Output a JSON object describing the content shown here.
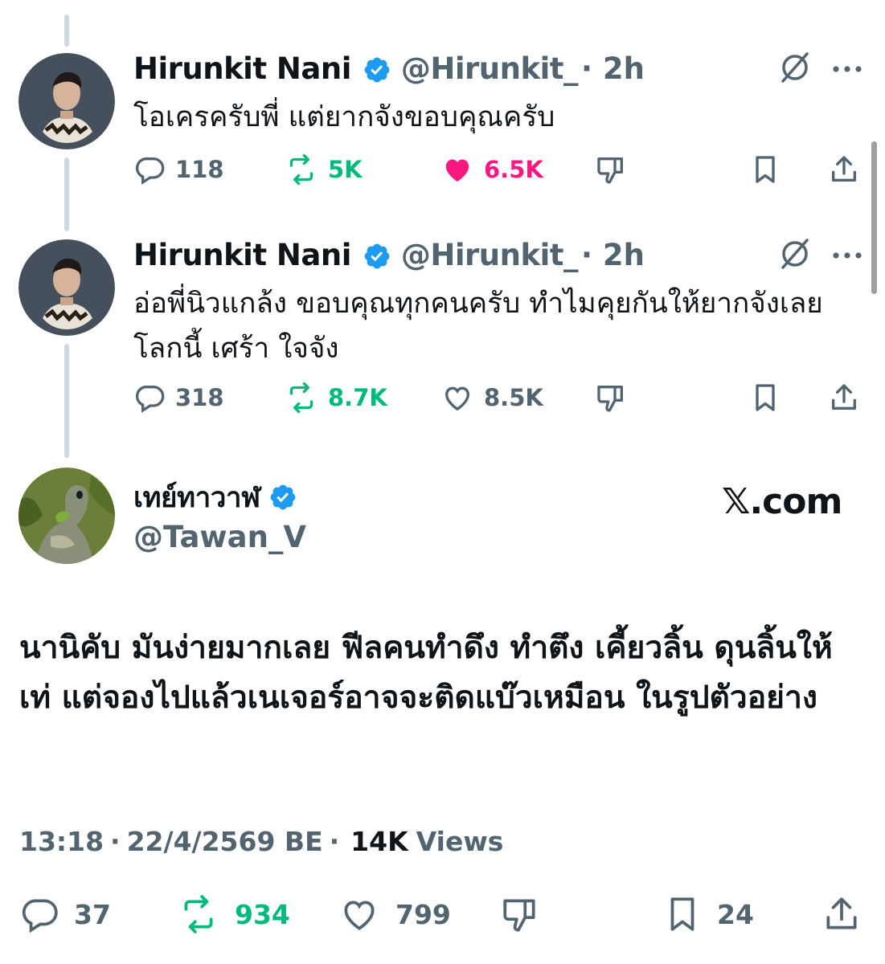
{
  "replies": [
    {
      "name": "Hirunkit Nani",
      "handle": "@Hirunkit_",
      "time": "· 2h",
      "text": "โอเครครับพี่ แต่ยากจังขอบคุณครับ",
      "comments": "118",
      "reposts": "5K",
      "likes": "6.5K",
      "liked": true
    },
    {
      "name": "Hirunkit Nani",
      "handle": "@Hirunkit_",
      "time": "· 2h",
      "text": "อ่อพี่นิวแกล้ง ขอบคุณทุกคนครับ ทำไมคุยกันให้ยากจังเลย โลกนี้ เศร้า ใจจัง",
      "comments": "318",
      "reposts": "8.7K",
      "likes": "8.5K",
      "liked": false
    }
  ],
  "main": {
    "name": "เทย์ทาวาฬ",
    "handle": "@Tawan_V",
    "source_label": "𝕏.com",
    "text": "นานิคับ มันง่ายมากเลย ฟีลคนทำดึง ทำตึง เคี้ยวลิ้น ดุนลิ้นให้เท่ แต่จองไปแล้วเนเจอร์อาจจะติดแบ๊วเหมือน ในรูปตัวอย่าง",
    "time": "13:18",
    "date": "22/4/2569 BE",
    "views_count": "14K",
    "views_label": "Views",
    "comments": "37",
    "reposts": "934",
    "likes": "799",
    "bookmarks": "24"
  },
  "colors": {
    "verified": "#1d9bf0",
    "repost": "#00ba7c",
    "like_active": "#f91880",
    "muted": "#536471",
    "thread_line": "#cfd9de"
  },
  "icons": [
    "reply-icon",
    "repost-icon",
    "like-icon",
    "dislike-icon",
    "bookmark-icon",
    "share-icon",
    "grok-icon",
    "more-icon",
    "verified-icon"
  ]
}
